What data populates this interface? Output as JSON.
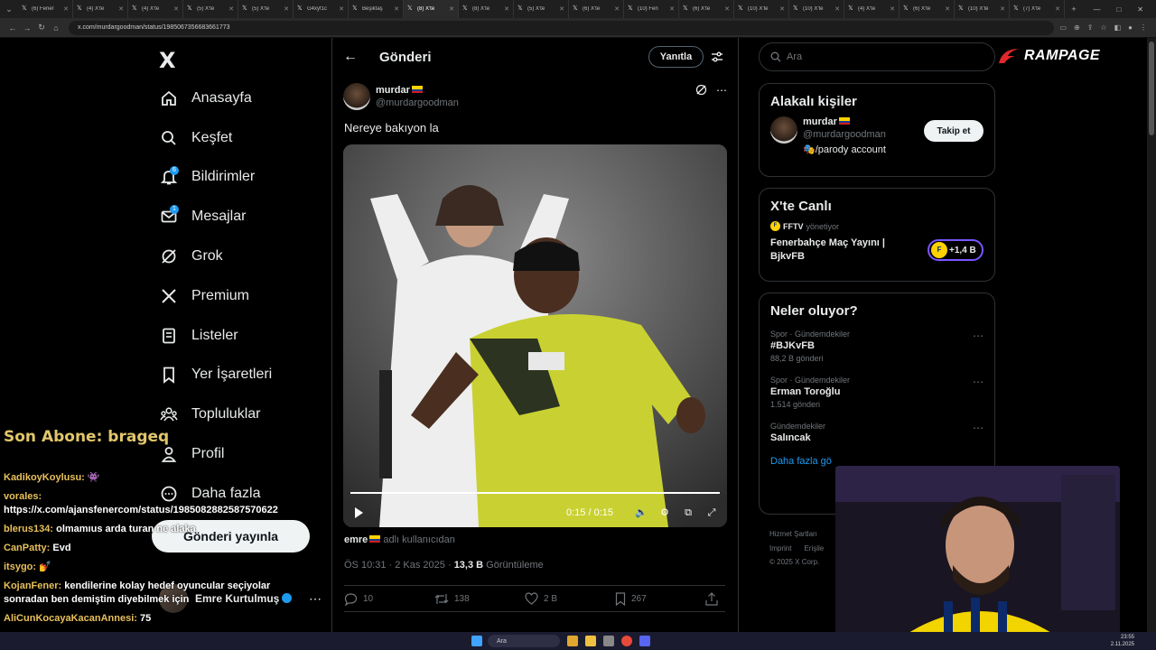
{
  "browser": {
    "tabs": [
      {
        "title": "(6) Fener",
        "active": false
      },
      {
        "title": "(4) X'te ",
        "active": false
      },
      {
        "title": "(4) X'te ",
        "active": false
      },
      {
        "title": "(5) X'te ",
        "active": false
      },
      {
        "title": "(5) X'te ",
        "active": false
      },
      {
        "title": "G4xyf1c",
        "active": false
      },
      {
        "title": "Beşiktaş",
        "active": false
      },
      {
        "title": "(8) X'te ",
        "active": true
      },
      {
        "title": "(8) X'te ",
        "active": false
      },
      {
        "title": "(5) X'te ",
        "active": false
      },
      {
        "title": "(6) X'te ",
        "active": false
      },
      {
        "title": "(10) Fen",
        "active": false
      },
      {
        "title": "(6) X'te ",
        "active": false
      },
      {
        "title": "(10) X'te",
        "active": false
      },
      {
        "title": "(10) X'te",
        "active": false
      },
      {
        "title": "(4) X'te ",
        "active": false
      },
      {
        "title": "(6) X'te ",
        "active": false
      },
      {
        "title": "(10) X'te",
        "active": false
      },
      {
        "title": "(7) X'te ",
        "active": false
      }
    ],
    "url": "x.com/murdargoodman/status/1985067356683661773"
  },
  "nav": {
    "logo": "X",
    "items": [
      {
        "label": "Anasayfa",
        "icon": "home-icon"
      },
      {
        "label": "Keşfet",
        "icon": "search-icon"
      },
      {
        "label": "Bildirimler",
        "icon": "bell-icon",
        "badge": "6"
      },
      {
        "label": "Mesajlar",
        "icon": "mail-icon",
        "badge": "1"
      },
      {
        "label": "Grok",
        "icon": "grok-icon"
      },
      {
        "label": "Premium",
        "icon": "x-premium-icon"
      },
      {
        "label": "Listeler",
        "icon": "list-icon"
      },
      {
        "label": "Yer İşaretleri",
        "icon": "bookmark-icon"
      },
      {
        "label": "Topluluklar",
        "icon": "communities-icon"
      },
      {
        "label": "Profil",
        "icon": "profile-icon"
      },
      {
        "label": "Daha fazla",
        "icon": "more-circle-icon"
      }
    ],
    "post_button": "Gönderi yayınla",
    "account": {
      "name": "Emre Kurtulmuş"
    }
  },
  "main": {
    "header_title": "Gönderi",
    "reply_button": "Yanıtla",
    "author": {
      "name": "murdar",
      "handle": "@murdargoodman"
    },
    "text": "Nereye bakıyon la",
    "video": {
      "time": "0:15 / 0:15",
      "progress": 1.0
    },
    "source": {
      "user": "emre",
      "suffix": "adlı kullanıcıdan"
    },
    "meta": {
      "datetime": "ÖS 10:31 · 2 Kas 2025 · ",
      "views": "13,3 B",
      "views_label": " Görüntüleme"
    },
    "stats": {
      "replies": "10",
      "reposts": "138",
      "likes": "2 B",
      "bookmarks": "267"
    }
  },
  "right": {
    "search_placeholder": "Ara",
    "brand": "RAMPAGE",
    "related": {
      "title": "Alakalı kişiler",
      "person": {
        "name": "murdar",
        "handle": "@murdargoodman",
        "bio": "🎭/parody account"
      },
      "follow": "Takip et"
    },
    "live": {
      "title": "X'te Canlı",
      "host": "FFTV",
      "host_suffix": "yönetiyor",
      "show": "Fenerbahçe Maç Yayını | BjkvFB",
      "listeners": "+1,4 B"
    },
    "trends": {
      "title": "Neler oluyor?",
      "items": [
        {
          "category": "Spor · Gündemdekiler",
          "name": "#BJKvFB",
          "count": "88,2 B gönderi"
        },
        {
          "category": "Spor · Gündemdekiler",
          "name": "Erman Toroğlu",
          "count": "1.514 gönderi"
        },
        {
          "category": "Gündemdekiler",
          "name": "Salıncak",
          "count": ""
        }
      ],
      "show_more": "Daha fazla gö"
    },
    "footer": [
      "Hizmet Şartları",
      "Imprint",
      "Erişile",
      "© 2025 X Corp."
    ]
  },
  "overlay": {
    "son_abone": "Son Abone: brageq",
    "chat": [
      {
        "user": "KadikoyKoylusu:",
        "msg": "👾"
      },
      {
        "user": "vorales:",
        "msg": "https://x.com/ajansfenercom/status/1985082882587570622"
      },
      {
        "user": "blerus134:",
        "msg": "olmamıus arda turan ne alaka"
      },
      {
        "user": "CanPatty:",
        "msg": "Evd"
      },
      {
        "user": "itsygo:",
        "msg": "💅"
      },
      {
        "user": "KojanFener:",
        "msg": "kendilerine kolay hedef oyuncular seçiyolar sonradan ben demiştim diyebilmek için"
      },
      {
        "user": "AliCunKocayaKacanAnnesi:",
        "msg": "75"
      }
    ]
  },
  "taskbar": {
    "search": "Ara",
    "time": "23:55",
    "date": "2.11.2025"
  }
}
